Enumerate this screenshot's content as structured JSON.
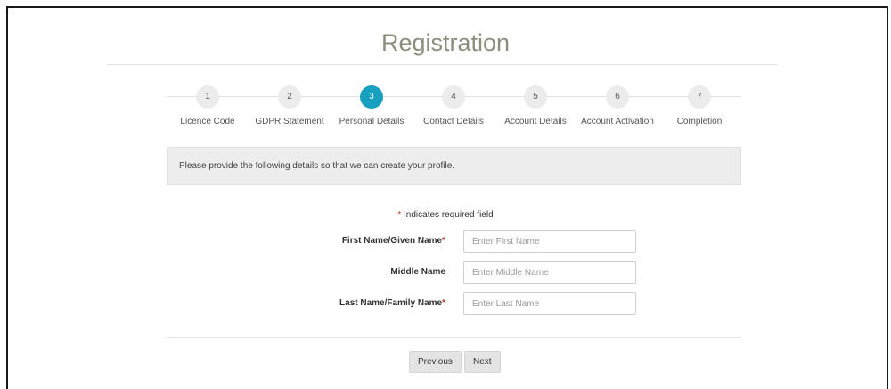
{
  "page": {
    "title": "Registration"
  },
  "steps": [
    {
      "number": "1",
      "label": "Licence Code",
      "active": false
    },
    {
      "number": "2",
      "label": "GDPR Statement",
      "active": false
    },
    {
      "number": "3",
      "label": "Personal Details",
      "active": true
    },
    {
      "number": "4",
      "label": "Contact Details",
      "active": false
    },
    {
      "number": "5",
      "label": "Account Details",
      "active": false
    },
    {
      "number": "6",
      "label": "Account Activation",
      "active": false
    },
    {
      "number": "7",
      "label": "Completion",
      "active": false
    }
  ],
  "info": {
    "message": "Please provide the following details so that we can create your profile."
  },
  "required_note": {
    "star": "*",
    "text": " Indicates required field"
  },
  "form": {
    "first_name": {
      "label": "First Name/Given Name",
      "required_star": "*",
      "placeholder": "Enter First Name",
      "value": ""
    },
    "middle_name": {
      "label": "Middle Name",
      "placeholder": "Enter Middle Name",
      "value": ""
    },
    "last_name": {
      "label": "Last Name/Family Name",
      "required_star": "*",
      "placeholder": "Enter Last Name",
      "value": ""
    }
  },
  "buttons": {
    "previous": "Previous",
    "next": "Next"
  },
  "colors": {
    "active_step": "#17a0bf",
    "required": "#c0392b",
    "title": "#8d8d7e"
  }
}
